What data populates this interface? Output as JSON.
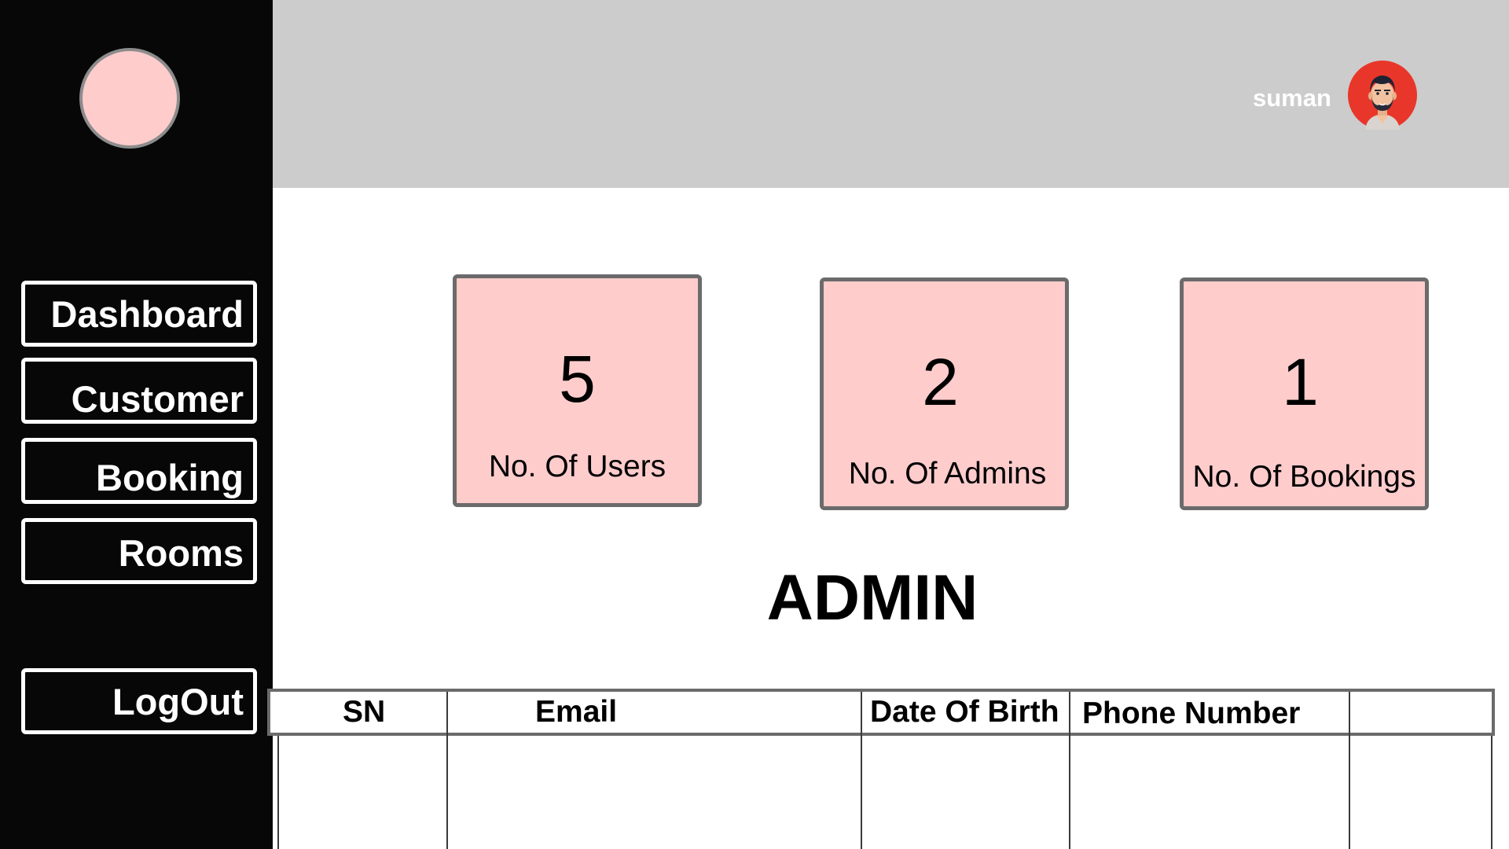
{
  "user": {
    "name": "suman",
    "avatar_icon": "user-avatar-icon"
  },
  "sidebar": {
    "logo_icon": "logo-circle-icon",
    "items": [
      {
        "label": "Dashboard"
      },
      {
        "label": "Customer"
      },
      {
        "label": "Booking"
      },
      {
        "label": "Rooms"
      }
    ],
    "logout_label": "LogOut"
  },
  "stats": [
    {
      "value": "5",
      "label": "No. Of Users"
    },
    {
      "value": "2",
      "label": "No. Of Admins"
    },
    {
      "value": "1",
      "label": "No. Of Bookings"
    }
  ],
  "page": {
    "title": "ADMIN"
  },
  "table": {
    "columns": [
      "SN",
      "Email",
      "Date Of Birth",
      "Phone Number",
      ""
    ]
  },
  "colors": {
    "sidebar_bg": "#070707",
    "header_bg": "#cccccc",
    "card_bg": "#ffcccc",
    "card_border": "#6b6b6b",
    "avatar_bg": "#e8372a"
  }
}
